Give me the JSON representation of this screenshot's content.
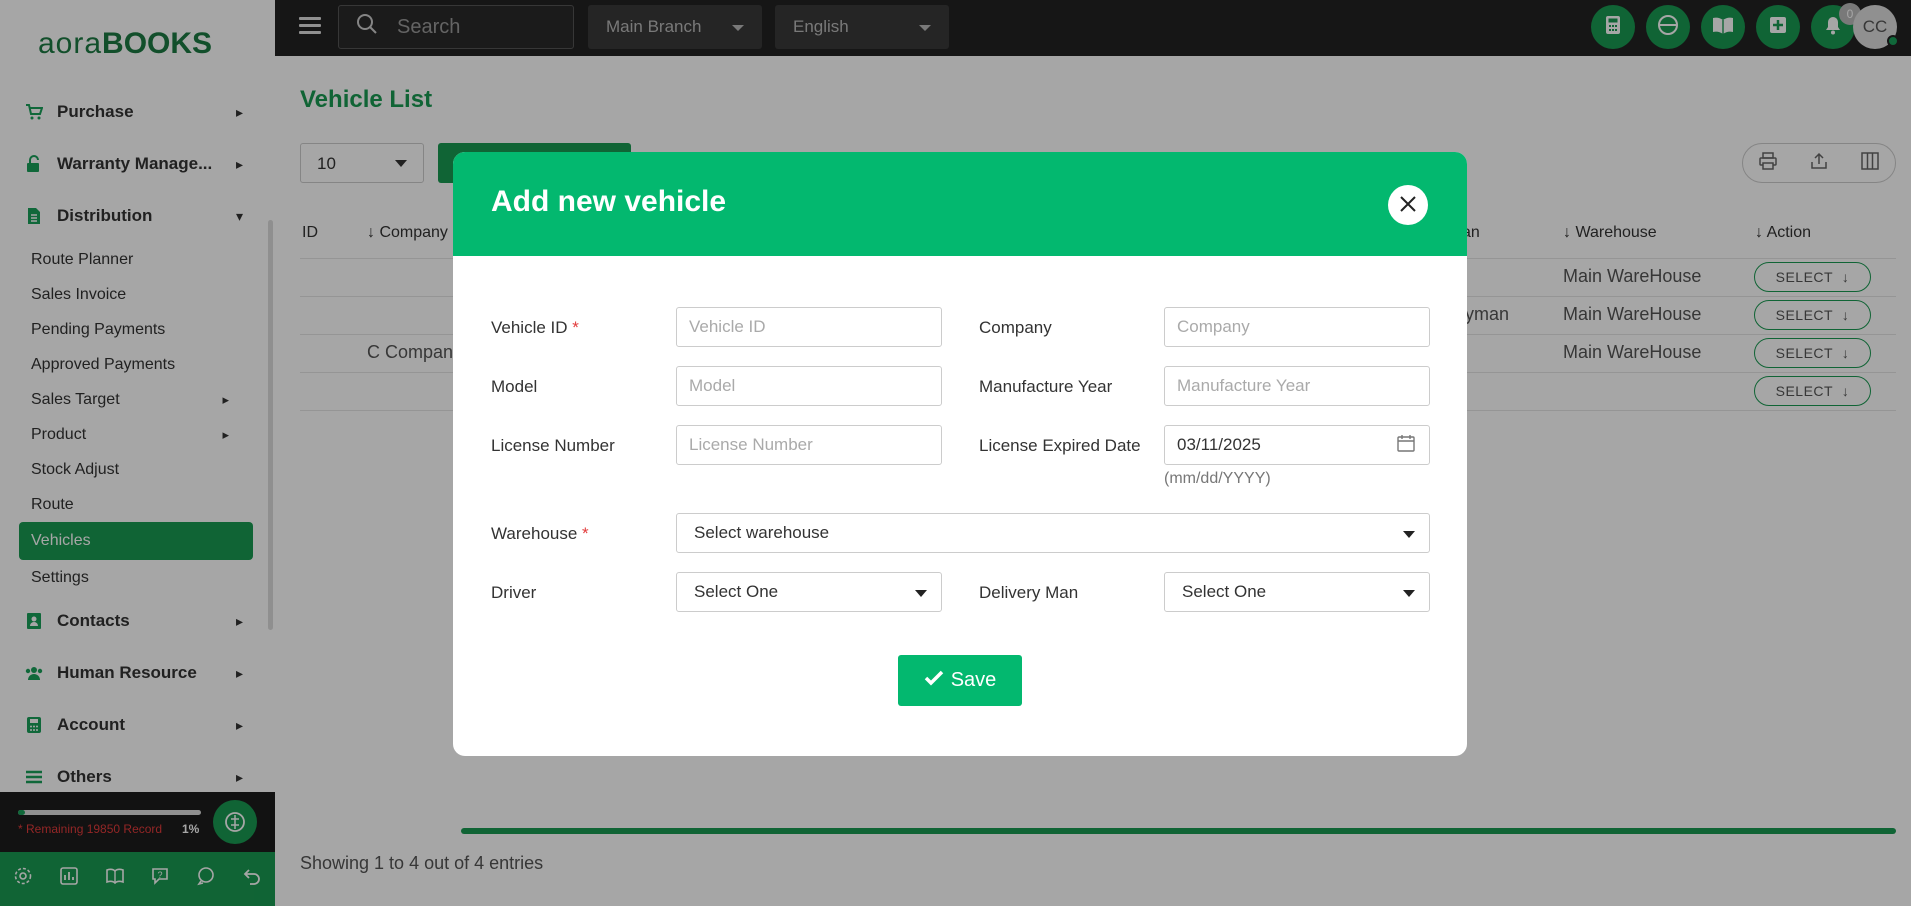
{
  "app": {
    "logo_part1": "aora",
    "logo_part2": "BOOKS"
  },
  "sidebar": {
    "items": [
      {
        "label": "Purchase",
        "icon": "cart-icon"
      },
      {
        "label": "Warranty Manage...",
        "icon": "lock-open-icon"
      },
      {
        "label": "Distribution",
        "icon": "document-icon"
      }
    ],
    "distribution_sub": [
      {
        "label": "Route Planner"
      },
      {
        "label": "Sales Invoice"
      },
      {
        "label": "Pending Payments"
      },
      {
        "label": "Approved Payments"
      },
      {
        "label": "Sales Target"
      },
      {
        "label": "Product"
      },
      {
        "label": "Stock Adjust"
      },
      {
        "label": "Route"
      },
      {
        "label": "Vehicles"
      },
      {
        "label": "Settings"
      }
    ],
    "items_after": [
      {
        "label": "Contacts",
        "icon": "contacts-icon"
      },
      {
        "label": "Human Resource",
        "icon": "people-icon"
      },
      {
        "label": "Account",
        "icon": "calculator-icon"
      },
      {
        "label": "Others",
        "icon": "list-icon"
      }
    ],
    "remaining_text": "* Remaining 19850 Record",
    "remaining_pct": "1%",
    "progress_fraction": 0.01
  },
  "topbar": {
    "search_placeholder": "Search",
    "branch": "Main Branch",
    "language": "English",
    "notification_count": "0",
    "avatar_initials": "CC"
  },
  "main": {
    "title": "Vehicle List",
    "per_page": "10",
    "columns": [
      "ID",
      "Company",
      "an",
      "Warehouse",
      "Action"
    ],
    "rows": [
      {
        "company": "",
        "man": "",
        "warehouse": "Main WareHouse",
        "action": "SELECT"
      },
      {
        "company": "",
        "man": "yman",
        "warehouse": "Main WareHouse",
        "action": "SELECT"
      },
      {
        "company": "C Compan",
        "man": "",
        "warehouse": "Main WareHouse",
        "action": "SELECT"
      },
      {
        "company": "",
        "man": "",
        "warehouse": "",
        "action": "SELECT"
      }
    ],
    "showing": "Showing 1 to 4 out of 4 entries"
  },
  "modal": {
    "title": "Add new vehicle",
    "vehicle_id_label": "Vehicle ID",
    "vehicle_id_placeholder": "Vehicle ID",
    "company_label": "Company",
    "company_placeholder": "Company",
    "model_label": "Model",
    "model_placeholder": "Model",
    "manufacture_year_label": "Manufacture Year",
    "manufacture_year_placeholder": "Manufacture Year",
    "license_number_label": "License Number",
    "license_number_placeholder": "License Number",
    "license_expired_label": "License Expired Date",
    "license_expired_value": "03/11/2025",
    "license_expired_hint": "(mm/dd/YYYY)",
    "warehouse_label": "Warehouse",
    "warehouse_value": "Select warehouse",
    "driver_label": "Driver",
    "driver_value": "Select One",
    "delivery_man_label": "Delivery Man",
    "delivery_man_value": "Select One",
    "required_mark": "*",
    "save_label": "Save"
  },
  "colors": {
    "brand_green": "#1a9a52",
    "modal_green": "#03b86f",
    "required_red": "#e23b3b"
  }
}
